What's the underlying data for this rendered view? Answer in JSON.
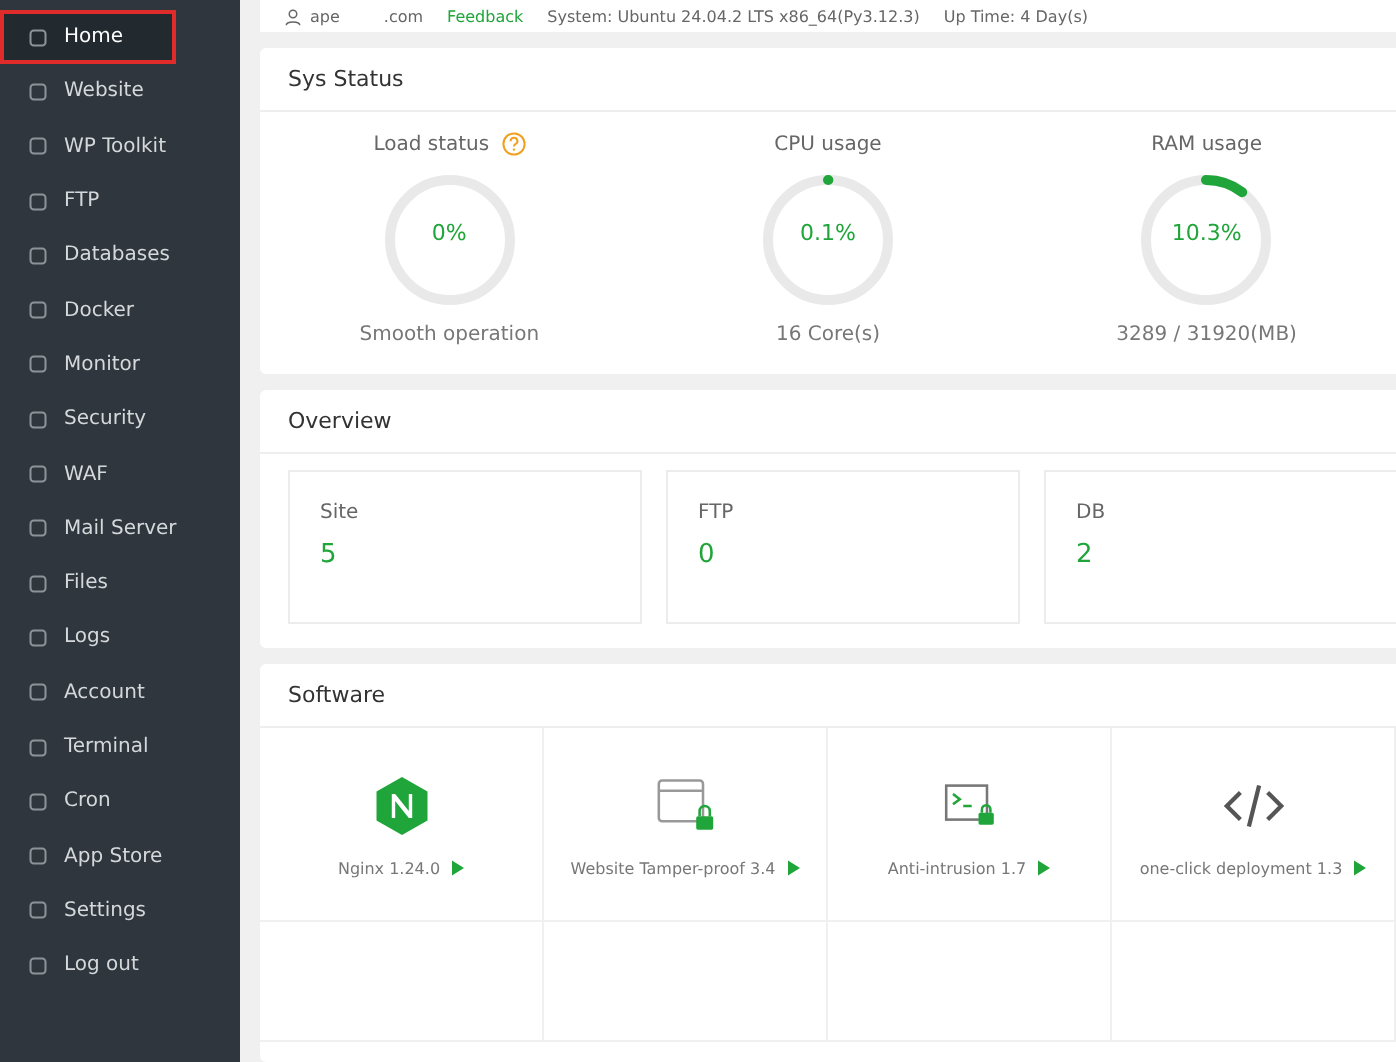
{
  "sidebar": {
    "items": [
      {
        "label": "Home",
        "selected": true
      },
      {
        "label": "Website",
        "selected": false
      },
      {
        "label": "WP Toolkit",
        "selected": false
      },
      {
        "label": "FTP",
        "selected": false
      },
      {
        "label": "Databases",
        "selected": false
      },
      {
        "label": "Docker",
        "selected": false
      },
      {
        "label": "Monitor",
        "selected": false
      },
      {
        "label": "Security",
        "selected": false
      },
      {
        "label": "WAF",
        "selected": false
      },
      {
        "label": "Mail Server",
        "selected": false
      },
      {
        "label": "Files",
        "selected": false
      },
      {
        "label": "Logs",
        "selected": false
      },
      {
        "label": "Account",
        "selected": false
      },
      {
        "label": "Terminal",
        "selected": false
      },
      {
        "label": "Cron",
        "selected": false
      },
      {
        "label": "App Store",
        "selected": false
      },
      {
        "label": "Settings",
        "selected": false
      },
      {
        "label": "Log out",
        "selected": false
      }
    ]
  },
  "top_bar": {
    "user": "ape",
    "domain": ".com",
    "feedback": "Feedback",
    "system": "System: Ubuntu 24.04.2 LTS x86_64(Py3.12.3)",
    "uptime": "Up Time: 4 Day(s)"
  },
  "sys_status": {
    "title": "Sys Status",
    "gauges": [
      {
        "label": "Load status",
        "help": true,
        "value": "0%",
        "level": 0,
        "caption": "Smooth operation"
      },
      {
        "label": "CPU usage",
        "help": false,
        "value": "0.1%",
        "level": 0.001,
        "caption": "16 Core(s)"
      },
      {
        "label": "RAM usage",
        "help": false,
        "value": "10.3%",
        "level": 0.103,
        "caption": "3289 / 31920(MB)"
      }
    ]
  },
  "overview": {
    "title": "Overview",
    "cards": [
      {
        "label": "Site",
        "value": "5"
      },
      {
        "label": "FTP",
        "value": "0"
      },
      {
        "label": "DB",
        "value": "2"
      }
    ]
  },
  "software": {
    "title": "Software",
    "items": [
      {
        "kind": "nginx",
        "name": "Nginx 1.24.0"
      },
      {
        "kind": "tamper",
        "name": "Website Tamper-proof 3.4"
      },
      {
        "kind": "intrusion",
        "name": "Anti-intrusion 1.7"
      },
      {
        "kind": "deploy",
        "name": "one-click deployment 1.3"
      }
    ]
  }
}
